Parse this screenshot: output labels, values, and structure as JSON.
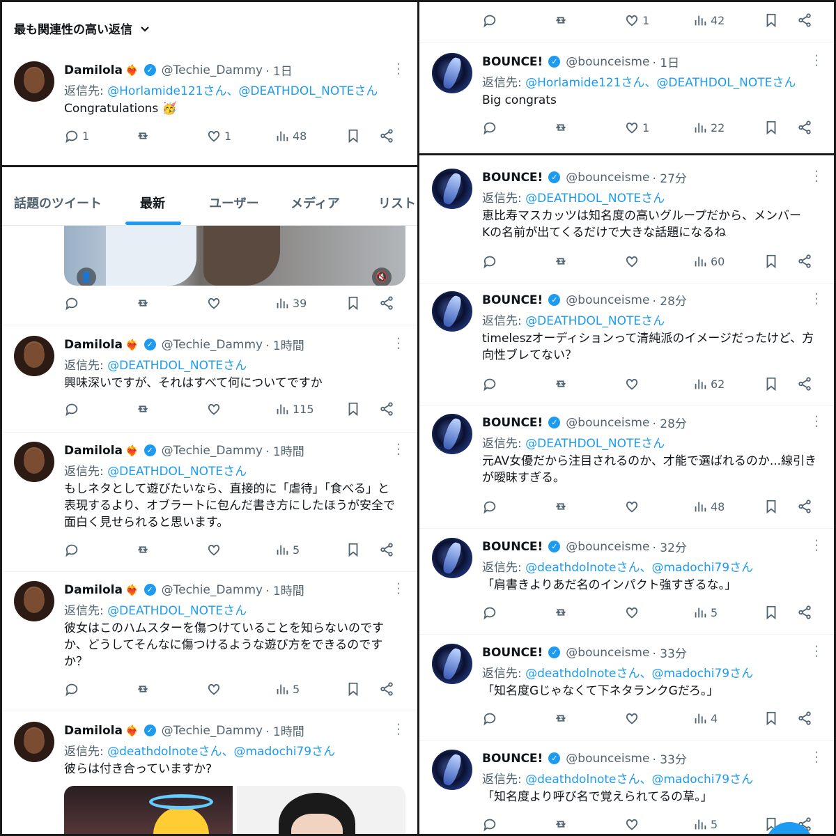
{
  "top_left": {
    "sort_label": "最も関連性の高い返信",
    "tweet": {
      "name": "Damilola",
      "handle": "@Techie_Dammy",
      "time": "· 1日",
      "reply_prefix": "返信先: ",
      "reply_targets": "@Horlamide121さん、@DEATHDOL_NOTEさん",
      "text": "Congratulations 🥳",
      "replies": "1",
      "likes": "1",
      "views": "48"
    }
  },
  "tabs": [
    "話題のツイート",
    "最新",
    "ユーザー",
    "メディア",
    "リスト"
  ],
  "left_tweets": [
    {
      "views": "39"
    },
    {
      "name": "Damilola",
      "handle": "@Techie_Dammy",
      "time": "· 1時間",
      "reply_prefix": "返信先: ",
      "reply_targets": "@DEATHDOL_NOTEさん",
      "text": "興味深いですが、それはすべて何についてですか",
      "views": "115"
    },
    {
      "name": "Damilola",
      "handle": "@Techie_Dammy",
      "time": "· 1時間",
      "reply_prefix": "返信先: ",
      "reply_targets": "@DEATHDOL_NOTEさん",
      "text_lines": [
        "もしネタとして遊びたいなら、直接的に「虐待」「食べる」と",
        "表現するより、オブラートに包んだ書き方にしたほうが安全で",
        "面白く見せられると思います。"
      ],
      "views": "5"
    },
    {
      "name": "Damilola",
      "handle": "@Techie_Dammy",
      "time": "· 1時間",
      "reply_prefix": "返信先: ",
      "reply_targets": "@DEATHDOL_NOTEさん",
      "text_lines": [
        "彼女はこのハムスターを傷つけていることを知らないのです",
        "か、どうしてそんなに傷つけるような遊び方をできるのです",
        "か？"
      ],
      "views": "5"
    },
    {
      "name": "Damilola",
      "handle": "@Techie_Dammy",
      "time": "· 1時間",
      "reply_prefix": "返信先: ",
      "reply_targets": "@deathdolnoteさん、@madochi79さん",
      "text": "彼らは付き合っていますか?"
    }
  ],
  "right_top": {
    "row1": {
      "likes": "1",
      "views": "42"
    },
    "tweet": {
      "name": "BOUNCE!",
      "handle": "@bounceisme",
      "time": "· 1日",
      "reply_prefix": "返信先: ",
      "reply_targets": "@Horlamide121さん、@DEATHDOL_NOTEさん",
      "text": "Big congrats",
      "likes": "1",
      "views": "22"
    }
  },
  "right_tweets": [
    {
      "name": "BOUNCE!",
      "handle": "@bounceisme",
      "time": "· 27分",
      "reply_prefix": "返信先: ",
      "reply_targets": "@DEATHDOL_NOTEさん",
      "text_lines": [
        "恵比寿マスカッツは知名度の高いグループだから、メンバー",
        "Kの名前が出てくるだけで大きな話題になるね"
      ],
      "views": "60"
    },
    {
      "name": "BOUNCE!",
      "handle": "@bounceisme",
      "time": "· 28分",
      "reply_prefix": "返信先: ",
      "reply_targets": "@DEATHDOL_NOTEさん",
      "text_lines": [
        "timeleszオーディションって清純派のイメージだったけど、方",
        "向性ブレてない？"
      ],
      "views": "62"
    },
    {
      "name": "BOUNCE!",
      "handle": "@bounceisme",
      "time": "· 28分",
      "reply_prefix": "返信先: ",
      "reply_targets": "@DEATHDOL_NOTEさん",
      "text_lines": [
        "元AV女優だから注目されるのか、才能で選ばれるのか...線引き",
        "が曖昧すぎる。"
      ],
      "views": "48"
    },
    {
      "name": "BOUNCE!",
      "handle": "@bounceisme",
      "time": "· 32分",
      "reply_prefix": "返信先: ",
      "reply_targets": "@deathdolnoteさん、@madochi79さん",
      "text": "「肩書きよりあだ名のインパクト強すぎるな。」",
      "views": "5"
    },
    {
      "name": "BOUNCE!",
      "handle": "@bounceisme",
      "time": "· 33分",
      "reply_prefix": "返信先: ",
      "reply_targets": "@deathdolnoteさん、@madochi79さん",
      "text": "「知名度Gじゃなくて下ネタランクGだろ。」",
      "views": "4"
    },
    {
      "name": "BOUNCE!",
      "handle": "@bounceisme",
      "time": "· 33分",
      "reply_prefix": "返信先: ",
      "reply_targets": "@deathdolnoteさん、@madochi79さん",
      "text": "「知名度より呼び名で覚えられてるの草。」",
      "views": "5"
    }
  ],
  "icons": {
    "reply": "reply-icon",
    "retweet": "retweet-icon",
    "like": "heart-icon",
    "views": "views-icon",
    "bookmark": "bookmark-icon",
    "share": "share-icon",
    "verified": "verified-badge-icon",
    "more": "more-options-icon"
  },
  "colors": {
    "accent": "#1d9bf0",
    "text": "#0f1419",
    "muted": "#536471"
  }
}
